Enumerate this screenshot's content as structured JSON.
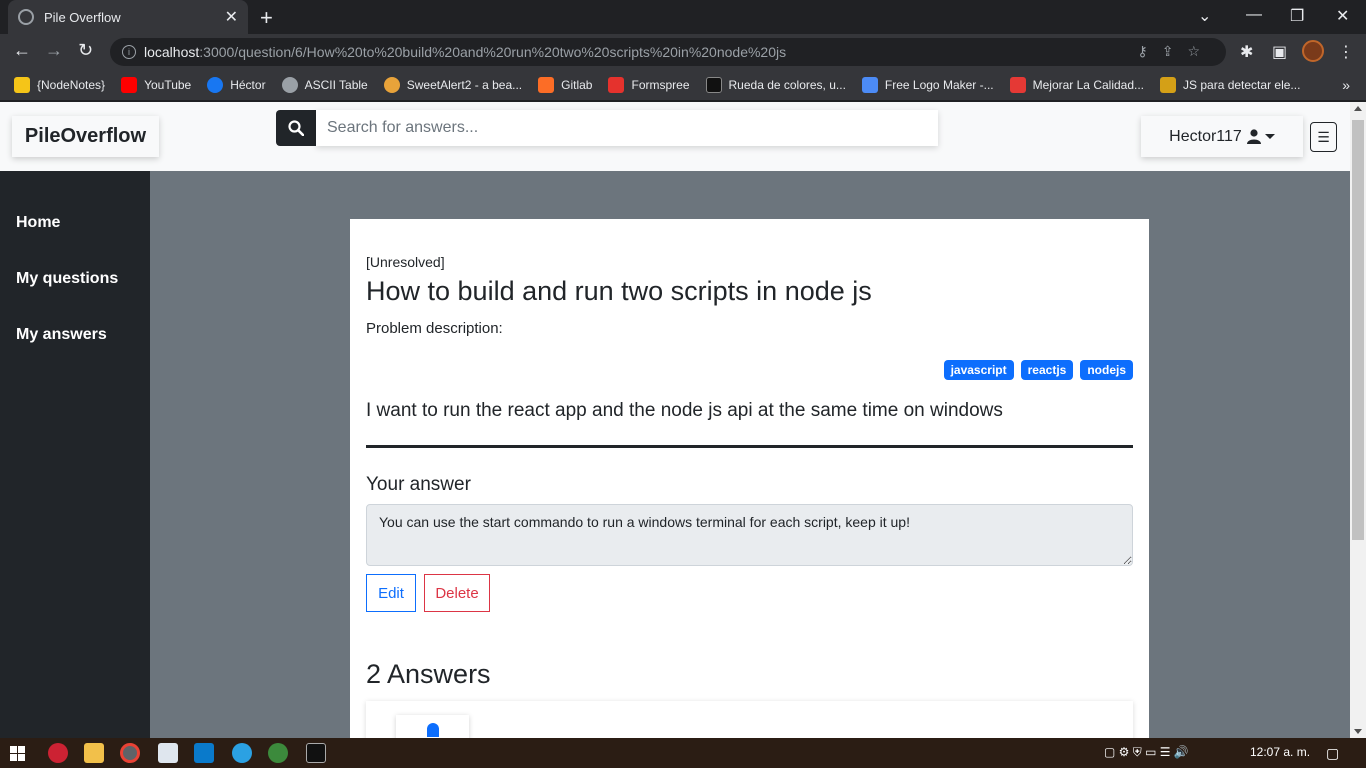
{
  "browser": {
    "tab_title": "Pile Overflow",
    "url_host": "localhost",
    "url_path": ":3000/question/6/How%20to%20build%20and%20run%20two%20scripts%20in%20node%20js",
    "bookmarks": [
      {
        "label": "{NodeNotes}",
        "color": "#f5c518"
      },
      {
        "label": "YouTube",
        "color": "#ff0000"
      },
      {
        "label": "Héctor",
        "color": "#1877f2"
      },
      {
        "label": "ASCII Table",
        "color": "#9aa0a6"
      },
      {
        "label": "SweetAlert2 - a bea...",
        "color": "#e8a33a"
      },
      {
        "label": "Gitlab",
        "color": "#fc6d26"
      },
      {
        "label": "Formspree",
        "color": "#e5322d"
      },
      {
        "label": "Rueda de colores, u...",
        "color": "#111111"
      },
      {
        "label": "Free Logo Maker -...",
        "color": "#4c8bf5"
      },
      {
        "label": "Mejorar La Calidad...",
        "color": "#e53935"
      },
      {
        "label": "JS para detectar ele...",
        "color": "#d4a017"
      }
    ]
  },
  "nav": {
    "brand": "PileOverflow",
    "search_placeholder": "Search for answers...",
    "username": "Hector117"
  },
  "sidebar": {
    "items": [
      "Home",
      "My questions",
      "My answers"
    ]
  },
  "question": {
    "status": "[Unresolved]",
    "title": "How to build and run two scripts in node js",
    "description_label": "Problem description:",
    "tags": [
      "javascript",
      "reactjs",
      "nodejs"
    ],
    "body": "I want to run the react app and the node js api at the same time on windows"
  },
  "your_answer": {
    "heading": "Your answer",
    "text": "You can use the start commando to run a windows terminal for each script, keep it up!",
    "edit_label": "Edit",
    "delete_label": "Delete"
  },
  "answers": {
    "count_label": "2 Answers"
  },
  "taskbar": {
    "clock": "12:07 a. m."
  },
  "colors": {
    "primary": "#0d6efd",
    "danger": "#dc3545",
    "dark": "#212529",
    "page_bg": "#6c757d"
  }
}
